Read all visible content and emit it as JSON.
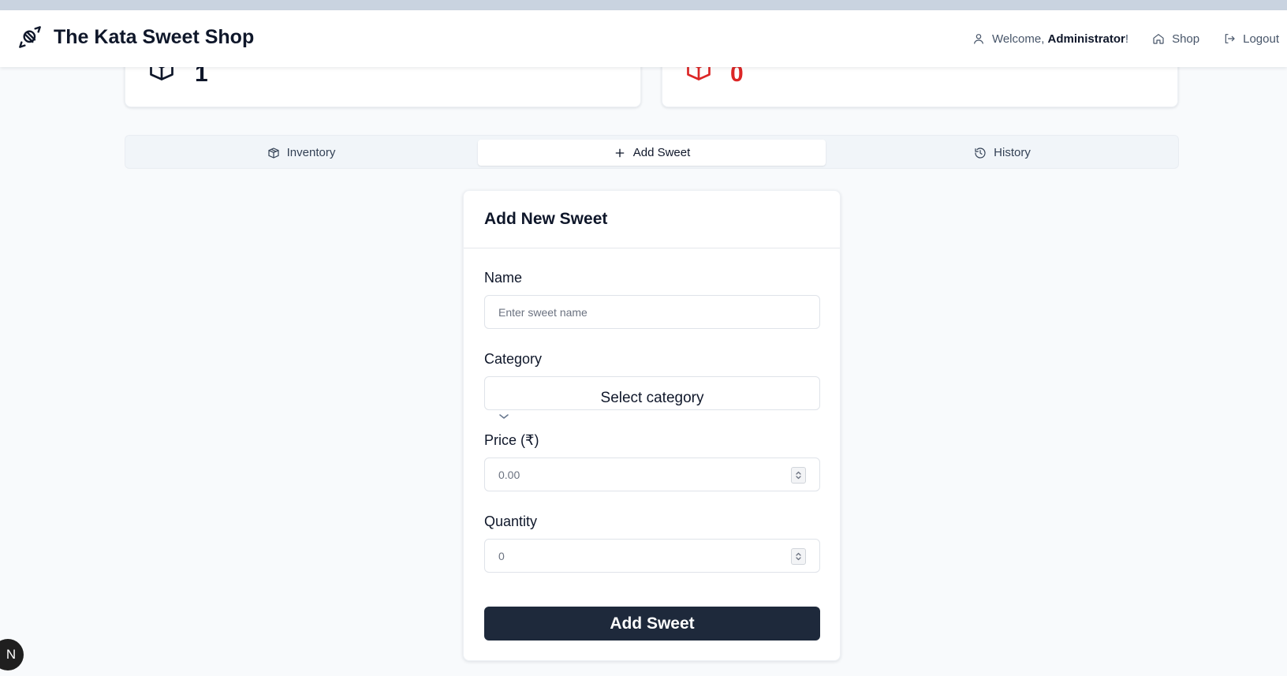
{
  "header": {
    "title": "The Kata Sweet Shop",
    "welcome_prefix": "Welcome, ",
    "user_name": "Administrator",
    "welcome_suffix": "!",
    "shop_label": "Shop",
    "logout_label": "Logout"
  },
  "stats": {
    "left_value": "1",
    "right_value": "0"
  },
  "tabs": [
    {
      "label": "Inventory",
      "icon": "package-icon",
      "active": false
    },
    {
      "label": "Add Sweet",
      "icon": "plus-icon",
      "active": true
    },
    {
      "label": "History",
      "icon": "history-icon",
      "active": false
    }
  ],
  "form": {
    "title": "Add New Sweet",
    "name_label": "Name",
    "name_placeholder": "Enter sweet name",
    "category_label": "Category",
    "category_value": "Select category",
    "price_label": "Price (₹)",
    "price_placeholder": "0.00",
    "quantity_label": "Quantity",
    "quantity_placeholder": "0",
    "submit_label": "Add Sweet"
  },
  "badge": {
    "label": "N"
  },
  "colors": {
    "primary_button": "#1e293b",
    "danger": "#dc2626",
    "background": "#f8fafc"
  }
}
